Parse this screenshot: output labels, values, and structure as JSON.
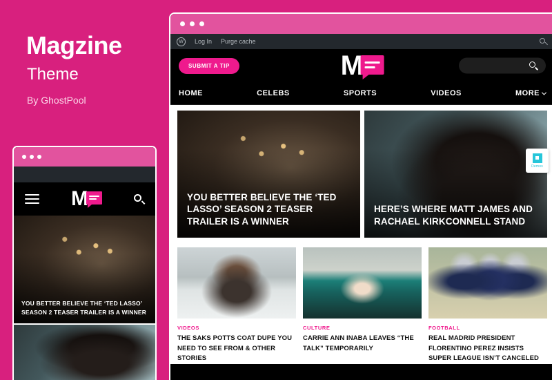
{
  "promo": {
    "title": "Magzine",
    "subtitle": "Theme",
    "author": "By GhostPool"
  },
  "colors": {
    "brand_pink": "#d8207e",
    "accent_pink": "#ef1a8d",
    "titlebar_pink": "#e2539e",
    "admin_dark": "#23282d",
    "demos_cyan": "#26c6da"
  },
  "browser": {
    "admin_bar": {
      "wp_logo": "wordpress-icon",
      "login_label": "Log In",
      "purge_label": "Purge cache",
      "search_icon": "search-icon"
    },
    "header": {
      "submit_tip_label": "Submit a tip",
      "logo_letter": "M",
      "logo_icon": "speech-bubble-icon",
      "search_placeholder": "",
      "search_value": "",
      "search_icon": "search-icon"
    },
    "nav": {
      "items": [
        {
          "label": "Home"
        },
        {
          "label": "Celebs"
        },
        {
          "label": "Sports"
        },
        {
          "label": "Videos"
        },
        {
          "label": "More",
          "has_dropdown": true
        }
      ]
    },
    "hero": [
      {
        "title": "You Better Believe The ‘Ted Lasso’ Season 2 Teaser Trailer Is A Winner",
        "photo": "ph-ted"
      },
      {
        "title": "Here’s Where Matt James And Rachael Kirkconnell Stand",
        "photo": "ph-hat"
      }
    ],
    "cards": [
      {
        "category": "Videos",
        "title": "The Saks Potts Coat Dupe You Need To See From & Other Stories",
        "photo": "ph-snow"
      },
      {
        "category": "Culture",
        "title": "Carrie Ann Inaba Leaves “The Talk” Temporarily",
        "photo": "ph-sea"
      },
      {
        "category": "Football",
        "title": "Real Madrid President Florentino Perez Insists Super League Isn’t Canceled",
        "photo": "ph-football"
      }
    ]
  },
  "mobile": {
    "menu_icon": "hamburger-menu-icon",
    "logo_letter": "M",
    "logo_icon": "speech-bubble-icon",
    "search_icon": "search-icon",
    "hero_title": "You Better Believe The ‘Ted Lasso’ Season 2 Teaser Trailer Is A Winner"
  },
  "demos_badge": {
    "label": "Demos",
    "icon": "demos-square-icon"
  }
}
